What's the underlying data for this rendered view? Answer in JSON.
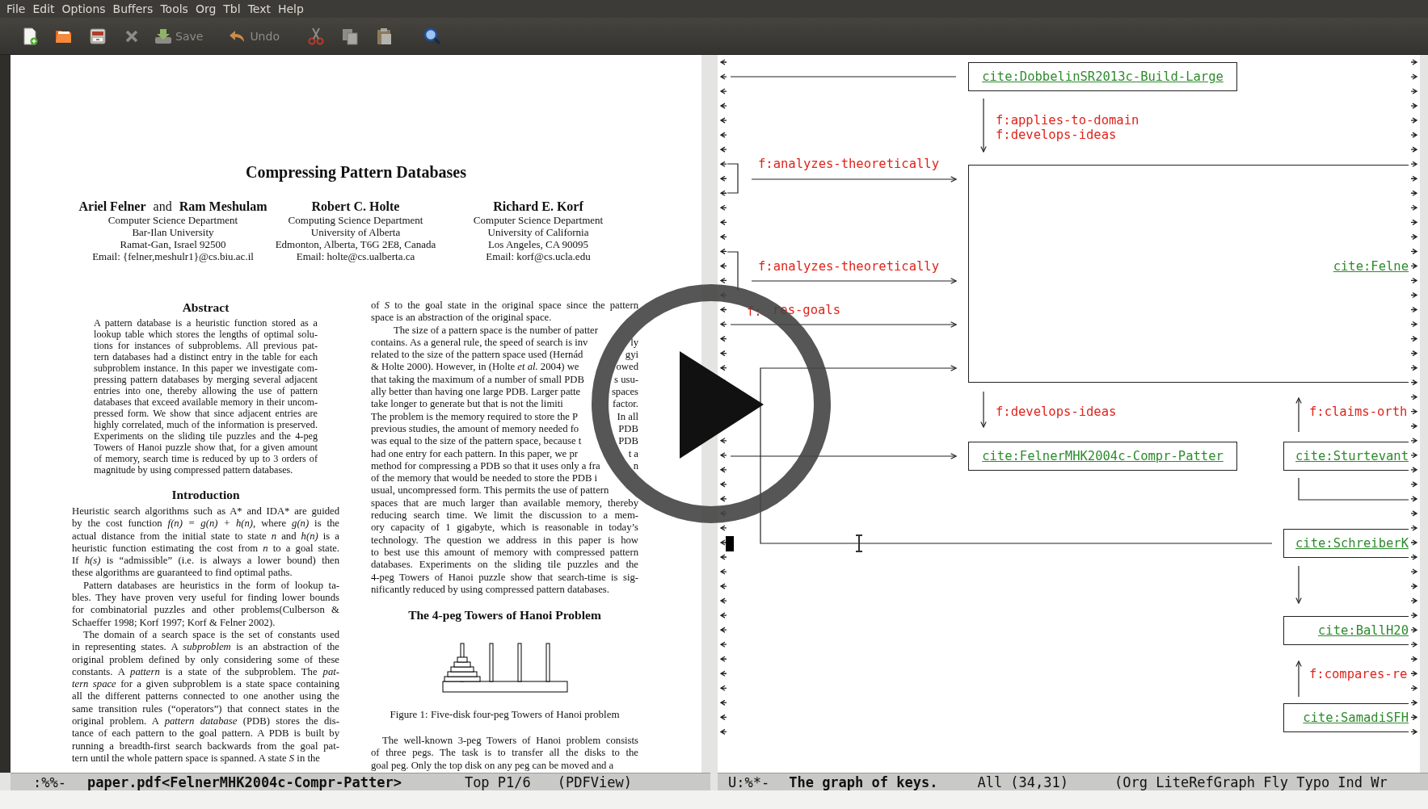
{
  "menu_bar": [
    "File",
    "Edit",
    "Options",
    "Buffers",
    "Tools",
    "Org",
    "Tbl",
    "Text",
    "Help"
  ],
  "toolbar": [
    {
      "kind": "new_file"
    },
    {
      "kind": "open"
    },
    {
      "kind": "dired"
    },
    {
      "kind": "close"
    },
    {
      "kind": "save",
      "label": "Save"
    },
    {
      "kind": "undo",
      "label": "Undo"
    },
    {
      "kind": "cut"
    },
    {
      "kind": "copy"
    },
    {
      "kind": "paste"
    },
    {
      "kind": "search"
    }
  ],
  "pdf_page": {
    "title": "Compressing Pattern Databases",
    "authors": [
      {
        "names": [
          "Ariel Felner",
          "Ram Meshulam"
        ],
        "joiner": "and",
        "lines": [
          "Computer Science Department",
          "Bar-Ilan University",
          "Ramat-Gan, Israel 92500",
          "Email: {felner,meshulr1}@cs.biu.ac.il"
        ]
      },
      {
        "names": [
          "Robert C. Holte"
        ],
        "lines": [
          "Computing Science Department",
          "University of Alberta",
          "Edmonton, Alberta, T6G 2E8, Canada",
          "Email: holte@cs.ualberta.ca"
        ]
      },
      {
        "names": [
          "Richard E. Korf"
        ],
        "lines": [
          "Computer Science Department",
          "University of California",
          "Los Angeles, CA 90095",
          "Email: korf@cs.ucla.edu"
        ]
      }
    ],
    "left_column": [
      {
        "kind": "heading",
        "text": "Abstract"
      },
      {
        "kind": "abstract",
        "indent": false,
        "lines": [
          "A pattern database is a heuristic function stored as a",
          "lookup table which stores the lengths of optimal solu-",
          "tions for instances of subproblems. All previous pat-",
          "tern databases had a distinct entry in the table for each",
          "subproblem instance. In this paper we investigate com-",
          "pressing pattern databases by merging several adjacent",
          "entries into one, thereby allowing the use of pattern",
          "databases that exceed available memory in their uncom-",
          "pressed form. We show that since adjacent entries are",
          "highly correlated, much of the information is preserved.",
          "Experiments on the sliding tile puzzles and the 4-peg",
          "Towers of Hanoi puzzle show that, for a given amount",
          "of memory, search time is reduced by up to 3 orders of",
          "magnitude by using compressed pattern databases."
        ]
      },
      {
        "kind": "heading",
        "text": "Introduction"
      },
      {
        "kind": "paragraph",
        "indent": false,
        "lines": [
          "Heuristic search algorithms such as A* and IDA* are guided",
          "by the cost function *f(n) = g(n) + h(n)*, where *g(n)* is the",
          "actual distance from the initial state to state *n* and *h(n)* is a",
          "heuristic function estimating the cost from *n* to a goal state.",
          "If *h(s)* is “admissible” (i.e. is always a lower bound) then",
          "these algorithms are guaranteed to find optimal paths."
        ]
      },
      {
        "kind": "paragraph",
        "indent": true,
        "lines": [
          "Pattern databases are heuristics in the form of lookup ta-",
          "bles. They have proven very useful for finding lower bounds",
          "for combinatorial puzzles and other problems(Culberson &",
          "Schaeffer 1998; Korf 1997; Korf & Felner 2002)."
        ]
      },
      {
        "kind": "paragraph",
        "indent": true,
        "lines": [
          "The domain of a search space is the set of constants used",
          "in representing states. A *subproblem* is an abstraction of the",
          "original problem defined by only considering some of these",
          "constants. A *pattern* is a state of the subproblem. The *pat-*",
          "*tern space* for a given subproblem is a state space containing",
          "all the different patterns connected to one another using the",
          "same transition rules (“operators”) that connect states in the",
          "original problem. A *pattern database* (PDB) stores the dis-",
          "tance of each pattern to the goal pattern. A PDB is built by",
          "running a breadth-first search backwards from the goal pat-",
          "tern until the whole pattern space is spanned. A state *S* in the"
        ]
      }
    ],
    "right_column": [
      {
        "kind": "paragraph",
        "indent": false,
        "lines": [
          "of *S* to the goal state in the original space since the pattern",
          "space is an abstraction of the original space."
        ]
      },
      {
        "kind": "paragraph",
        "indent": true,
        "lines": [
          [
            "The size of a pattern space is the number of patter"
          ],
          [
            "contains. As a general rule, the speed of search is inv",
            "ly"
          ],
          [
            "related to the size of the pattern space used (Hernád",
            "gyi"
          ],
          [
            "& Holte 2000). However, in (Holte *et al.* 2004) we",
            "owed"
          ],
          [
            "that taking the maximum of a number of small PDB",
            "s usu-"
          ],
          [
            "ally better than having one large PDB. Larger patte",
            "spaces"
          ],
          [
            "take longer to generate but that is not the limiti",
            "factor."
          ],
          [
            "The problem is the memory required to store the P",
            "In all"
          ],
          [
            "previous studies, the amount of memory needed fo",
            "PDB"
          ],
          [
            "was equal to the size of the pattern space, because t",
            "PDB"
          ],
          [
            "had one entry for each pattern. In this paper, we pr",
            "t a"
          ],
          [
            "method for compressing a PDB so that it uses only a fra",
            "n"
          ],
          [
            "of the memory that would be needed to store the PDB i"
          ],
          [
            "usual, uncompressed form. This permits the use of pattern"
          ],
          "spaces that are much larger than available memory, thereby",
          "reducing search time. We limit the discussion to a mem-",
          "ory capacity of 1 gigabyte, which is reasonable in today’s",
          "technology. The question we address in this paper is how",
          "to best use this amount of memory with compressed pattern",
          "databases. Experiments on the sliding tile puzzles and the",
          "4-peg Towers of Hanoi puzzle show that search-time is sig-",
          "nificantly reduced by using compressed pattern databases."
        ]
      },
      {
        "kind": "heading",
        "text": "The 4-peg Towers of Hanoi Problem"
      },
      {
        "kind": "figure",
        "caption": "Figure 1: Five-disk four-peg Towers of Hanoi problem"
      },
      {
        "kind": "paragraph",
        "indent": true,
        "lines": [
          "The well-known 3-peg Towers of Hanoi problem consists",
          "of three pegs. The task is to transfer all the disks to the",
          "goal peg. Only the top disk on any peg can be moved and a"
        ]
      }
    ]
  },
  "graph": {
    "nodes": [
      "cite:DobbelinSR2013c-Build-Large",
      "cite:Felne",
      "cite:FelnerMHK2004c-Compr-Patter",
      "cite:Sturtevant",
      "cite:SchreiberK",
      "cite:BallH20",
      "cite:SamadiSFH"
    ],
    "edge_labels": [
      "f:applies-to-domain",
      "f:develops-ideas",
      "f:analyzes-theoretically",
      "f:analyzes-theoretically",
      "f:",
      "res-goals",
      "f:develops-ideas",
      "f:claims-orth",
      "f:compares-re"
    ]
  },
  "mode_lines": [
    {
      "flags": ":%%-",
      "buffer": "paper.pdf<FelnerMHK2004c-Compr-Patter>",
      "position": "Top P1/6",
      "modes": "(PDFView)"
    },
    {
      "flags": "U:%*-",
      "buffer": "The graph of keys.",
      "position": "All (34,31)",
      "modes": "(Org LiteRefGraph Fly Typo Ind Wr"
    }
  ]
}
